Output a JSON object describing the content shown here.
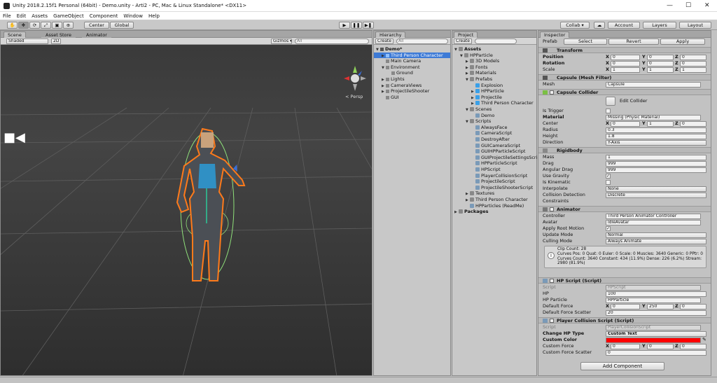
{
  "window": {
    "title": "Unity 2018.2.15f1 Personal (64bit) - Demo.unity - Arti2 - PC, Mac & Linux Standalone* <DX11>",
    "minimize": "—",
    "maximize": "☐",
    "close": "✕"
  },
  "menu": [
    "File",
    "Edit",
    "Assets",
    "GameObject",
    "Component",
    "Window",
    "Help"
  ],
  "toolbar": {
    "center": "Center",
    "global": "Global",
    "collab": "Collab ▾",
    "account": "Account",
    "layers": "Layers",
    "layout": "Layout",
    "tools": [
      "✋",
      "✥",
      "⟳",
      "⤢",
      "▣",
      "⊕"
    ],
    "play": "▶",
    "pause": "❚❚",
    "step": "▶❚",
    "cloud": "☁"
  },
  "scene": {
    "tabs": [
      "Scene",
      "Asset Store",
      "Animator"
    ],
    "shading": "Shaded",
    "mode2d": "2D",
    "gizmos": "Gizmos ▾",
    "search_placeholder": "All",
    "persp": "< Persp",
    "gizmo_axes": {
      "y": "y",
      "x": "x",
      "z": "z"
    }
  },
  "hierarchy": {
    "tab": "Hierarchy",
    "create": "Create ▾",
    "search_placeholder": "All",
    "items": [
      {
        "label": "Demo*",
        "depth": 0,
        "arrow": "▼",
        "bold": true,
        "selected": false
      },
      {
        "label": "Third Person Character",
        "depth": 1,
        "arrow": "▶",
        "bold": false,
        "selected": true
      },
      {
        "label": "Main Camera",
        "depth": 1,
        "arrow": "",
        "bold": false,
        "selected": false
      },
      {
        "label": "Environment",
        "depth": 1,
        "arrow": "▼",
        "bold": false,
        "selected": false
      },
      {
        "label": "Ground",
        "depth": 2,
        "arrow": "",
        "bold": false,
        "selected": false
      },
      {
        "label": "Lights",
        "depth": 1,
        "arrow": "▶",
        "bold": false,
        "selected": false
      },
      {
        "label": "CameraViews",
        "depth": 1,
        "arrow": "▶",
        "bold": false,
        "selected": false
      },
      {
        "label": "ProjectileShooter",
        "depth": 1,
        "arrow": "▶",
        "bold": false,
        "selected": false
      },
      {
        "label": "GUI",
        "depth": 1,
        "arrow": "",
        "bold": false,
        "selected": false
      }
    ]
  },
  "project": {
    "tab": "Project",
    "create": "Create ▾",
    "items": [
      {
        "label": "Assets",
        "depth": 0,
        "arrow": "▼",
        "type": "folder",
        "bold": true
      },
      {
        "label": "HPParticle",
        "depth": 1,
        "arrow": "▼",
        "type": "folder"
      },
      {
        "label": "3D Models",
        "depth": 2,
        "arrow": "▶",
        "type": "folder"
      },
      {
        "label": "Fonts",
        "depth": 2,
        "arrow": "▶",
        "type": "folder"
      },
      {
        "label": "Materials",
        "depth": 2,
        "arrow": "▶",
        "type": "folder"
      },
      {
        "label": "Prefabs",
        "depth": 2,
        "arrow": "▼",
        "type": "folder"
      },
      {
        "label": "Explosion",
        "depth": 3,
        "arrow": "",
        "type": "prefab"
      },
      {
        "label": "HPParticle",
        "depth": 3,
        "arrow": "▶",
        "type": "prefab"
      },
      {
        "label": "Projectile",
        "depth": 3,
        "arrow": "▶",
        "type": "prefab"
      },
      {
        "label": "Third Person Character",
        "depth": 3,
        "arrow": "▶",
        "type": "prefab"
      },
      {
        "label": "Scenes",
        "depth": 2,
        "arrow": "▼",
        "type": "folder"
      },
      {
        "label": "Demo",
        "depth": 3,
        "arrow": "",
        "type": "scene"
      },
      {
        "label": "Scripts",
        "depth": 2,
        "arrow": "▼",
        "type": "folder"
      },
      {
        "label": "AlwaysFace",
        "depth": 3,
        "arrow": "",
        "type": "script"
      },
      {
        "label": "CameraScript",
        "depth": 3,
        "arrow": "",
        "type": "script"
      },
      {
        "label": "DestroyAfter",
        "depth": 3,
        "arrow": "",
        "type": "script"
      },
      {
        "label": "GUICameraScript",
        "depth": 3,
        "arrow": "",
        "type": "script"
      },
      {
        "label": "GUIHPParticleScript",
        "depth": 3,
        "arrow": "",
        "type": "script"
      },
      {
        "label": "GUIProjectileSettingsScript",
        "depth": 3,
        "arrow": "",
        "type": "script"
      },
      {
        "label": "HPParticleScript",
        "depth": 3,
        "arrow": "",
        "type": "script"
      },
      {
        "label": "HPScript",
        "depth": 3,
        "arrow": "",
        "type": "script"
      },
      {
        "label": "PlayerCollisionScript",
        "depth": 3,
        "arrow": "",
        "type": "script"
      },
      {
        "label": "ProjectileScript",
        "depth": 3,
        "arrow": "",
        "type": "script"
      },
      {
        "label": "ProjectileShooterScript",
        "depth": 3,
        "arrow": "",
        "type": "script"
      },
      {
        "label": "Textures",
        "depth": 2,
        "arrow": "▶",
        "type": "folder"
      },
      {
        "label": "Third Person Character",
        "depth": 2,
        "arrow": "▶",
        "type": "folder"
      },
      {
        "label": "HPParticles (ReadMe)",
        "depth": 2,
        "arrow": "",
        "type": "doc"
      },
      {
        "label": "Packages",
        "depth": 0,
        "arrow": "▶",
        "type": "folder",
        "bold": true
      }
    ]
  },
  "inspector": {
    "tab": "Inspector",
    "prefab_label": "Prefab",
    "prefab_select": "Select",
    "prefab_revert": "Revert",
    "prefab_apply": "Apply",
    "transform": {
      "title": "Transform",
      "position": {
        "label": "Position",
        "x": "0",
        "y": "0",
        "z": "0"
      },
      "rotation": {
        "label": "Rotation",
        "x": "0",
        "y": "0",
        "z": "0"
      },
      "scale": {
        "label": "Scale",
        "x": "1",
        "y": "1",
        "z": "1"
      }
    },
    "mesh_filter": {
      "title": "Capsule (Mesh Filter)",
      "mesh_label": "Mesh",
      "mesh": "Capsule"
    },
    "capsule_collider": {
      "title": "Capsule Collider",
      "edit": "Edit Collider",
      "is_trigger": "Is Trigger",
      "material_label": "Material",
      "material": "Missing (Physic Material)",
      "center_label": "Center",
      "cx": "0",
      "cy": "1",
      "cz": "0",
      "radius_label": "Radius",
      "radius": "0.3",
      "height_label": "Height",
      "height": "1.8",
      "direction_label": "Direction",
      "direction": "Y-Axis"
    },
    "rigidbody": {
      "title": "Rigidbody",
      "mass_label": "Mass",
      "mass": "1",
      "drag_label": "Drag",
      "drag": "999",
      "angular_label": "Angular Drag",
      "angular": "999",
      "gravity_label": "Use Gravity",
      "kinematic_label": "Is Kinematic",
      "interpolate_label": "Interpolate",
      "interpolate": "None",
      "collision_label": "Collision Detection",
      "collision": "Discrete",
      "constraints": "Constraints"
    },
    "animator": {
      "title": "Animator",
      "controller_label": "Controller",
      "controller": "Third Person Animator Controller",
      "avatar_label": "Avatar",
      "avatar": "IdleAvatar",
      "root_label": "Apply Root Motion",
      "update_label": "Update Mode",
      "update": "Normal",
      "culling_label": "Culling Mode",
      "culling": "Always Animate",
      "info1": "Clip Count: 28",
      "info2": "Curves Pos: 0 Quat: 0 Euler: 0 Scale: 0 Muscles: 3640 Generic: 0 PPtr: 0",
      "info3": "Curves Count: 3640 Constant: 434 (11.9%) Dense: 226 (6.2%) Stream:",
      "info4": "2980 (81.9%)"
    },
    "hp_script": {
      "title": "HP Script (Script)",
      "script_label": "Script",
      "script": "HPScript",
      "hp_label": "HP",
      "hp": "100",
      "particle_label": "HP Particle",
      "particle": "HPParticle",
      "force_label": "Default Force",
      "fx": "0",
      "fy": "250",
      "fz": "0",
      "scatter_label": "Default Force Scatter",
      "scatter": "20"
    },
    "player_collision": {
      "title": "Player Collision Script (Script)",
      "script_label": "Script",
      "script": "PlayerCollisionScript",
      "type_label": "Change HP Type",
      "type": "Custom Text",
      "color_label": "Custom Color",
      "color": "#ff0000",
      "cforce_label": "Custom Force",
      "cfx": "0",
      "cfy": "0",
      "cfz": "0",
      "cscatter_label": "Custom Force Scatter",
      "cscatter": "0"
    },
    "add_component": "Add Component"
  },
  "colors": {
    "selection": "#3d7ad6",
    "outline": "#ff7a1a",
    "collider": "#8fe07a"
  }
}
